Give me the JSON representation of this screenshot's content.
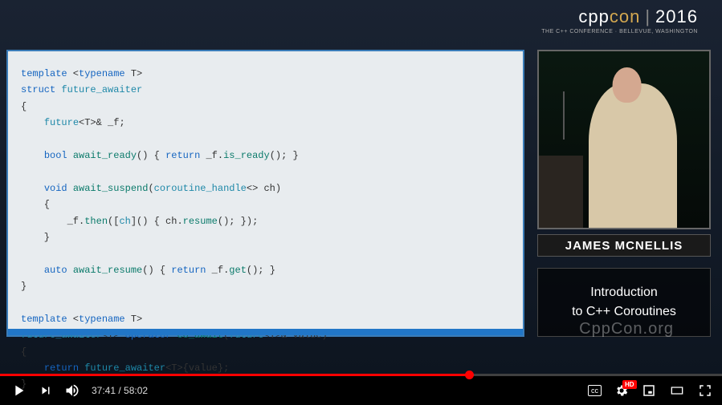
{
  "brand": {
    "cpp": "cpp",
    "con": "con",
    "sep": "|",
    "year": "2016",
    "subtitle": "THE C++ CONFERENCE · BELLEVUE, WASHINGTON"
  },
  "slide": {
    "lines": [
      {
        "segs": [
          [
            "kw",
            "template"
          ],
          [
            "plain",
            " <"
          ],
          [
            "kw",
            "typename"
          ],
          [
            "plain",
            " T>"
          ]
        ]
      },
      {
        "segs": [
          [
            "kw",
            "struct"
          ],
          [
            "plain",
            " "
          ],
          [
            "tp",
            "future_awaiter"
          ]
        ]
      },
      {
        "segs": [
          [
            "plain",
            "{"
          ]
        ]
      },
      {
        "segs": [
          [
            "plain",
            "    "
          ],
          [
            "tp",
            "future"
          ],
          [
            "plain",
            "<T>& _f;"
          ]
        ]
      },
      {
        "segs": [
          [
            "plain",
            " "
          ]
        ]
      },
      {
        "segs": [
          [
            "plain",
            "    "
          ],
          [
            "kw",
            "bool"
          ],
          [
            "plain",
            " "
          ],
          [
            "fn",
            "await_ready"
          ],
          [
            "plain",
            "() { "
          ],
          [
            "kw",
            "return"
          ],
          [
            "plain",
            " _f."
          ],
          [
            "fn",
            "is_ready"
          ],
          [
            "plain",
            "(); }"
          ]
        ]
      },
      {
        "segs": [
          [
            "plain",
            " "
          ]
        ]
      },
      {
        "segs": [
          [
            "plain",
            "    "
          ],
          [
            "kw",
            "void"
          ],
          [
            "plain",
            " "
          ],
          [
            "fn",
            "await_suspend"
          ],
          [
            "plain",
            "("
          ],
          [
            "tp",
            "coroutine_handle"
          ],
          [
            "plain",
            "<> ch)"
          ]
        ]
      },
      {
        "segs": [
          [
            "plain",
            "    {"
          ]
        ]
      },
      {
        "segs": [
          [
            "plain",
            "        _f."
          ],
          [
            "fn",
            "then"
          ],
          [
            "plain",
            "(["
          ],
          [
            "tp",
            "ch"
          ],
          [
            "plain",
            "]() { ch."
          ],
          [
            "fn",
            "resume"
          ],
          [
            "plain",
            "(); });"
          ]
        ]
      },
      {
        "segs": [
          [
            "plain",
            "    }"
          ]
        ]
      },
      {
        "segs": [
          [
            "plain",
            " "
          ]
        ]
      },
      {
        "segs": [
          [
            "plain",
            "    "
          ],
          [
            "kw",
            "auto"
          ],
          [
            "plain",
            " "
          ],
          [
            "fn",
            "await_resume"
          ],
          [
            "plain",
            "() { "
          ],
          [
            "kw",
            "return"
          ],
          [
            "plain",
            " _f."
          ],
          [
            "fn",
            "get"
          ],
          [
            "plain",
            "(); }"
          ]
        ]
      },
      {
        "segs": [
          [
            "plain",
            "}"
          ]
        ]
      },
      {
        "segs": [
          [
            "plain",
            " "
          ]
        ]
      },
      {
        "segs": [
          [
            "kw",
            "template"
          ],
          [
            "plain",
            " <"
          ],
          [
            "kw",
            "typename"
          ],
          [
            "plain",
            " T>"
          ]
        ]
      },
      {
        "segs": [
          [
            "tp",
            "future_awaiter"
          ],
          [
            "plain",
            "<T> "
          ],
          [
            "kw",
            "operator"
          ],
          [
            "plain",
            " "
          ],
          [
            "fn",
            "co_await"
          ],
          [
            "plain",
            "("
          ],
          [
            "tp",
            "future"
          ],
          [
            "plain",
            "<T>& value)"
          ]
        ]
      },
      {
        "segs": [
          [
            "plain",
            "{"
          ]
        ]
      },
      {
        "segs": [
          [
            "plain",
            "    "
          ],
          [
            "kw",
            "return"
          ],
          [
            "plain",
            " "
          ],
          [
            "tp",
            "future_awaiter"
          ],
          [
            "plain",
            "<T>{value};"
          ]
        ]
      },
      {
        "segs": [
          [
            "plain",
            "}"
          ]
        ]
      }
    ]
  },
  "speaker_name": "JAMES MCNELLIS",
  "title_line1": "Introduction",
  "title_line2": "to C++ Coroutines",
  "watermark": "CppCon.org",
  "player": {
    "current_time": "37:41",
    "duration": "58:02",
    "time_sep": " / ",
    "played_pct": 65,
    "loaded_pct": 58,
    "cc": "cc",
    "hd": "HD"
  }
}
